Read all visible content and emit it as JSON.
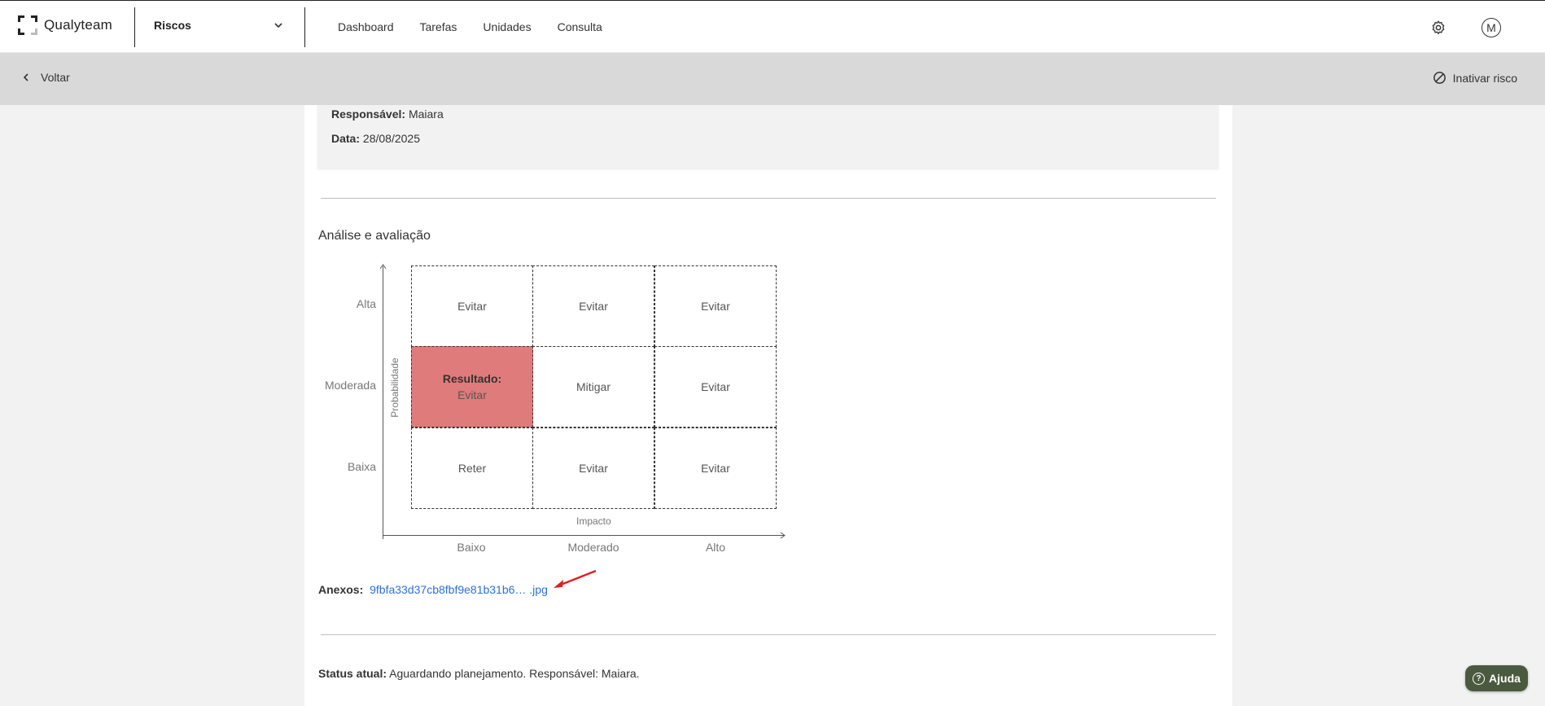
{
  "brand": {
    "name": "Qualyteam"
  },
  "module_selector": {
    "label": "Riscos"
  },
  "nav": {
    "items": [
      "Dashboard",
      "Tarefas",
      "Unidades",
      "Consulta"
    ]
  },
  "user": {
    "initial": "M"
  },
  "subbar": {
    "back_label": "Voltar",
    "inactivate_label": "Inativar risco"
  },
  "details": {
    "responsavel_label": "Responsável:",
    "responsavel_value": "Maiara",
    "data_label": "Data:",
    "data_value": "28/08/2025"
  },
  "analysis": {
    "title": "Análise e avaliação",
    "y_axis_title": "Probabilidade",
    "x_axis_title": "Impacto",
    "rows": [
      "Alta",
      "Moderada",
      "Baixa"
    ],
    "columns": [
      "Baixo",
      "Moderado",
      "Alto"
    ],
    "cells": [
      [
        "Evitar",
        "Evitar",
        "Evitar"
      ],
      [
        "Evitar",
        "Mitigar",
        "Evitar"
      ],
      [
        "Reter",
        "Evitar",
        "Evitar"
      ]
    ],
    "result_label": "Resultado:",
    "result_highlight_color": "#e07b7b"
  },
  "attachments": {
    "label": "Anexos:",
    "file": "9fbfa33d37cb8fbf9e81b31b6… .jpg"
  },
  "status": {
    "label": "Status atual:",
    "value": "Aguardando planejamento. Responsável: Maiara."
  },
  "help": {
    "label": "Ajuda"
  },
  "colors": {
    "accent_link": "#2f6fd6",
    "help_bg": "#4a5a3e",
    "annotation_arrow": "#e02020"
  }
}
